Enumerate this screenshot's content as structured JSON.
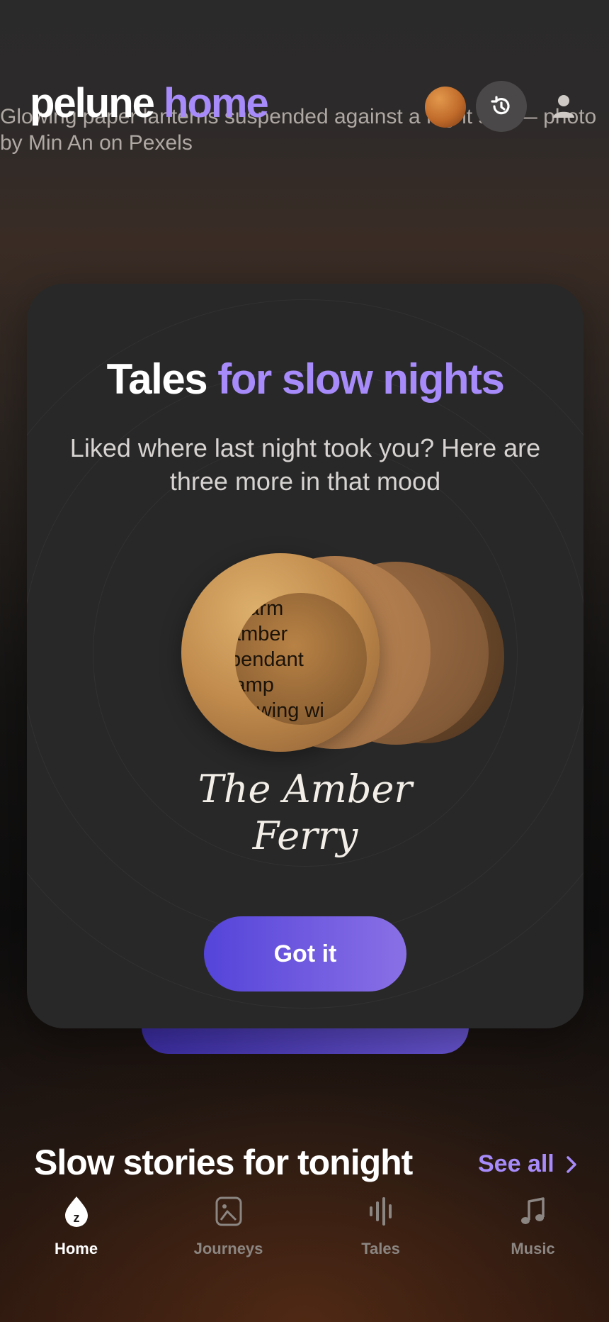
{
  "header": {
    "logo_main": "pelune",
    "logo_accent": "home",
    "hero_image_alt": "Glowing paper lanterns suspended against a night sky — photo by Min An on Pexels"
  },
  "modal": {
    "title_main": "Tales",
    "title_accent": "for slow nights",
    "subtitle": "Liked where last night took you? Here are three more in that mood",
    "cover_alt": "Warm amber pendant lamp glowing wi",
    "story_title_line1": "The Amber",
    "story_title_line2": "Ferry",
    "cta_label": "Got it"
  },
  "section": {
    "title": "Slow stories for tonight",
    "see_all": "See all"
  },
  "tabs": [
    {
      "label": "Home",
      "icon": "sleep-drop-icon",
      "active": true
    },
    {
      "label": "Journeys",
      "icon": "image-frame-icon",
      "active": false
    },
    {
      "label": "Tales",
      "icon": "soundwave-icon",
      "active": false
    },
    {
      "label": "Music",
      "icon": "music-note-icon",
      "active": false
    }
  ],
  "colors": {
    "accent": "#a78bfa",
    "cta_start": "#5444d9",
    "cta_end": "#8a70e6",
    "modal_bg": "#282828"
  }
}
